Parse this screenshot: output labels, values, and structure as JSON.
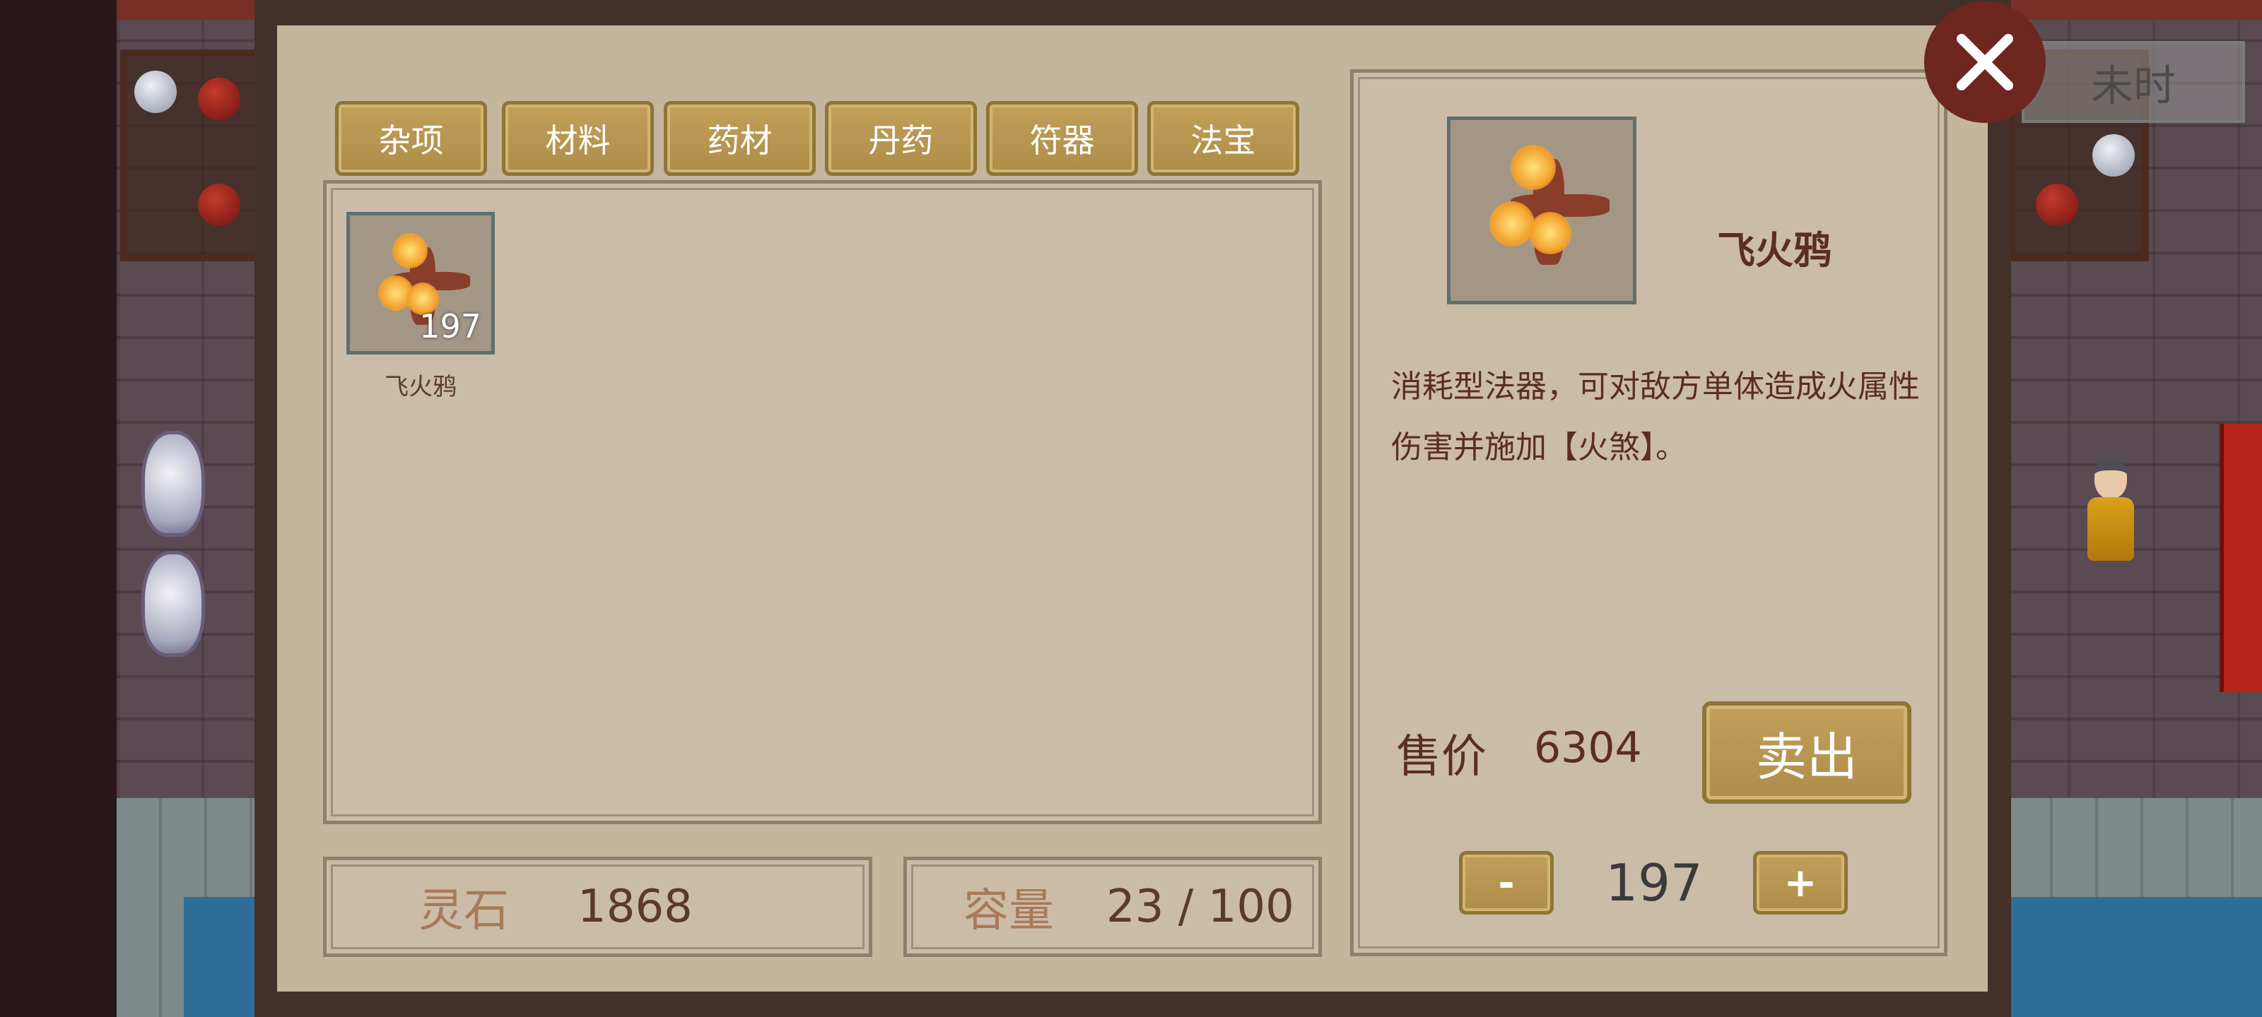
{
  "game": {
    "time_label": "未时"
  },
  "tabs": [
    {
      "label": "杂项"
    },
    {
      "label": "材料"
    },
    {
      "label": "药材"
    },
    {
      "label": "丹药"
    },
    {
      "label": "符器"
    },
    {
      "label": "法宝"
    }
  ],
  "inventory": {
    "items": [
      {
        "name": "飞火鸦",
        "count": "197",
        "icon": "fire-crow-icon"
      }
    ],
    "spirit_stone_label": "灵石",
    "spirit_stone_value": "1868",
    "capacity_label": "容量",
    "capacity_value": "23 / 100"
  },
  "detail": {
    "name": "飞火鸦",
    "icon": "fire-crow-icon",
    "description": "消耗型法器，可对敌方单体造成火属性伤害并施加【火煞】。",
    "price_label": "售价",
    "price_value": "6304",
    "sell_label": "卖出",
    "decrement_label": "-",
    "increment_label": "+",
    "quantity": "197"
  },
  "colors": {
    "panel_bg": "#c4b59d",
    "panel_border": "#433129",
    "button_gold": "#b8974f",
    "text_brown": "#5a2e22",
    "close_red": "#6d2620"
  }
}
